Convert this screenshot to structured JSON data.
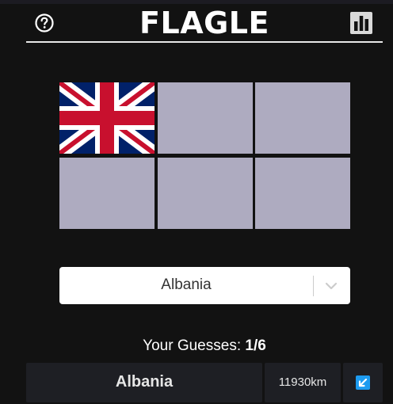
{
  "header": {
    "title": "FLAGLE",
    "help_icon": "question-circle-icon",
    "stats_icon": "bar-chart-icon"
  },
  "flag_grid": {
    "revealed_tiles": [
      0
    ],
    "hidden_tile_color": "#aeabc0"
  },
  "country_select": {
    "value": "Albania",
    "icon": "chevron-down-icon"
  },
  "guesses": {
    "label": "Your Guesses: ",
    "count": "1/6",
    "rows": [
      {
        "country": "Albania",
        "distance": "11930km",
        "direction_icon": "arrow-down-left-icon"
      }
    ]
  },
  "colors": {
    "background": "#121212",
    "cell": "#1e1f24",
    "accent": "#1d9bf0"
  }
}
